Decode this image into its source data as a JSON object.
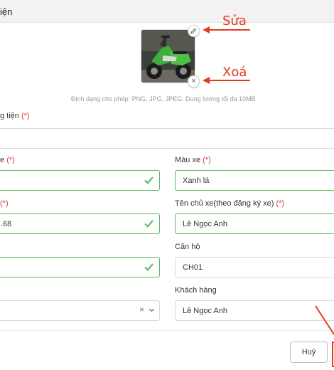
{
  "header": {
    "title": "iện"
  },
  "image_section": {
    "photo_alt_icon": "motorbike-photo",
    "edit_icon": "pencil-icon",
    "delete_icon": "close-icon",
    "delete_glyph": "×",
    "hint": "Định dạng cho phép: PNG, JPG, JPEG. Dung lượng tối đa 10MB"
  },
  "annotations": {
    "edit": "Sửa",
    "delete": "Xoá",
    "color": "#e63a1f"
  },
  "form": {
    "vehicle_type": {
      "label": "g tiện",
      "required_mark": "(*)",
      "value": ""
    },
    "left_col": {
      "field1": {
        "label": "e",
        "required_mark": "(*)",
        "value": ""
      },
      "field2": {
        "label": "",
        "required_mark": "(*)",
        "value": ".68"
      },
      "field3": {
        "value": ""
      },
      "field4": {
        "value": "",
        "clear_glyph": "×"
      }
    },
    "color": {
      "label": "Màu xe",
      "required_mark": "(*)",
      "value": "Xanh lá"
    },
    "owner": {
      "label": "Tên chủ xe(theo đăng ký xe)",
      "required_mark": "(*)",
      "value": "Lê Ngọc Anh"
    },
    "apartment": {
      "label": "Căn hộ",
      "value": "CH01"
    },
    "customer": {
      "label": "Khách hàng",
      "value": "Lê Ngọc Anh"
    }
  },
  "footer": {
    "cancel_label": "Huỷ"
  },
  "colors": {
    "valid": "#5cb85c",
    "required": "#d9363e"
  }
}
